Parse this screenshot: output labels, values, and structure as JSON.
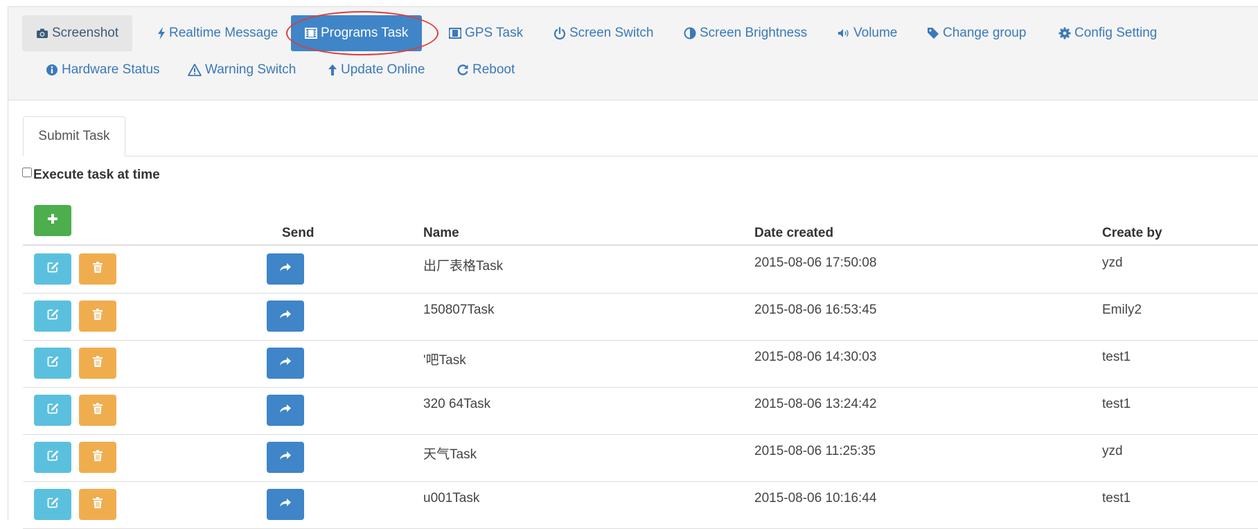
{
  "toolbar": {
    "row1": [
      {
        "label": "Screenshot",
        "icon": "camera-icon"
      },
      {
        "label": "Realtime Message",
        "icon": "bolt-icon"
      },
      {
        "label": "Programs Task",
        "icon": "film-icon"
      },
      {
        "label": "GPS Task",
        "icon": "film-icon"
      },
      {
        "label": "Screen Switch",
        "icon": "power-icon"
      },
      {
        "label": "Screen Brightness",
        "icon": "adjust-icon"
      },
      {
        "label": "Volume",
        "icon": "volume-icon"
      },
      {
        "label": "Change group",
        "icon": "tag-icon"
      },
      {
        "label": "Config Setting",
        "icon": "gear-icon"
      }
    ],
    "row2": [
      {
        "label": "Hardware Status",
        "icon": "info-icon"
      },
      {
        "label": "Warning Switch",
        "icon": "warning-icon"
      },
      {
        "label": "Update Online",
        "icon": "arrow-up-icon"
      },
      {
        "label": "Reboot",
        "icon": "refresh-icon"
      }
    ],
    "active": "Programs Task",
    "highlight_color": "#e23b3b"
  },
  "tab": {
    "label": "Submit Task"
  },
  "options": {
    "execute_at_time_label": "Execute task at time",
    "execute_at_time_checked": false
  },
  "table": {
    "headers": {
      "send": "Send",
      "name": "Name",
      "date_created": "Date created",
      "create_by": "Create by"
    },
    "rows": [
      {
        "name": "出厂表格Task",
        "date_created": "2015-08-06 17:50:08",
        "create_by": "yzd"
      },
      {
        "name": "150807Task",
        "date_created": "2015-08-06 16:53:45",
        "create_by": "Emily2"
      },
      {
        "name": "'吧Task",
        "date_created": "2015-08-06 14:30:03",
        "create_by": "test1"
      },
      {
        "name": "320 64Task",
        "date_created": "2015-08-06 13:24:42",
        "create_by": "test1"
      },
      {
        "name": "天气Task",
        "date_created": "2015-08-06 11:25:35",
        "create_by": "yzd"
      },
      {
        "name": "u001Task",
        "date_created": "2015-08-06 10:16:44",
        "create_by": "test1"
      }
    ]
  },
  "colors": {
    "primary": "#3f85c8",
    "success": "#4cae4c",
    "info": "#5bc0de",
    "warning": "#f0ad4e",
    "link": "#3a79b9"
  }
}
